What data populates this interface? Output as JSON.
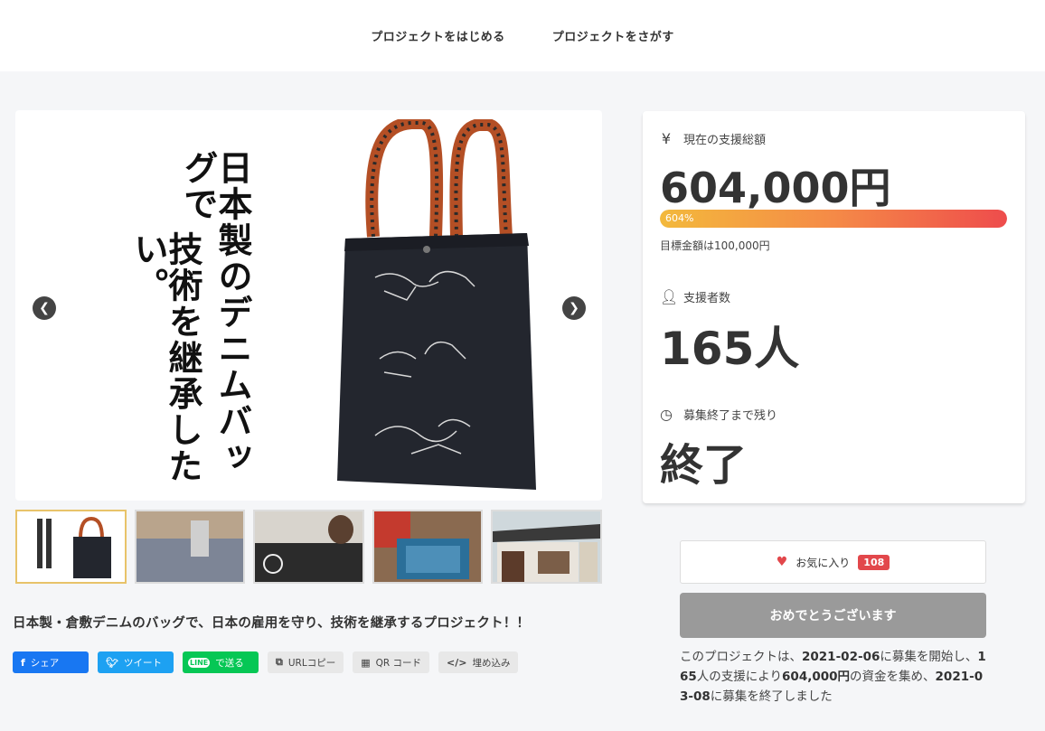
{
  "nav": {
    "start_label": "プロジェクトをはじめる",
    "search_label": "プロジェクトをさがす"
  },
  "hero": {
    "vertical_text_1": "日本製のデニムバッグで",
    "vertical_text_2": "技術を継承したい。"
  },
  "project": {
    "title": "日本製・倉敷デニムのバッグで、日本の雇用を守り、技術を継承するプロジェクト！！"
  },
  "share": {
    "facebook_label": "シェア",
    "twitter_label": "ツイート",
    "line_icon": "LINE",
    "line_label": "で送る",
    "url_copy_label": "URLコピー",
    "qr_label": "QR コード",
    "embed_label": "埋め込み"
  },
  "stats": {
    "total_label": "現在の支援総額",
    "total_value": "604,000円",
    "progress_text": "604%",
    "progress_fraction": 1.0,
    "goal_text": "目標金額は100,000円",
    "supporters_label": "支援者数",
    "supporters_value": "165人",
    "remaining_label": "募集終了まで残り",
    "remaining_value": "終了"
  },
  "actions": {
    "favorite_label": "お気に入り",
    "favorite_count": "108",
    "congrats_label": "おめでとうございます"
  },
  "summary": {
    "part1": "このプロジェクトは、",
    "start_date": "2021-02-06",
    "part2": "に募集を開始し、",
    "supporters": "165",
    "part3": "人の支援により",
    "amount": "604,000円",
    "part4": "の資金を集め、",
    "end_date": "2021-03-08",
    "part5": "に募集を終了しました"
  },
  "colors": {
    "facebook": "#1877f2",
    "twitter": "#1da1f2",
    "line": "#06c755",
    "heart": "#e2474b",
    "progress_start": "#f3b93c",
    "progress_end": "#ee4c4c"
  }
}
